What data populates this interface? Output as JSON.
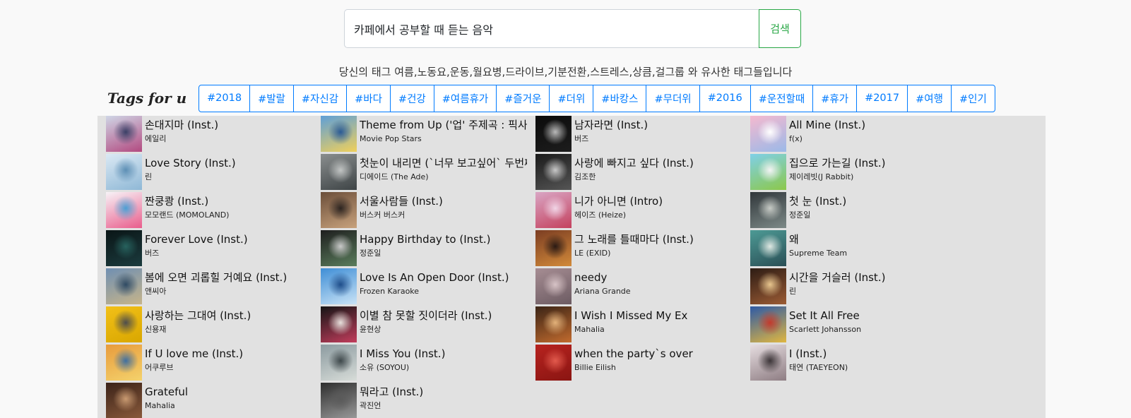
{
  "search": {
    "value": "카페에서 공부할 때 듣는 음악",
    "button_label": "검색"
  },
  "similar_text": "당신의 태그 여름,노동요,운동,월요병,드라이브,기분전환,스트레스,상큼,걸그룹 와 유사한 태그들입니다",
  "tags_title": "Tags for u",
  "tags": [
    "#2018",
    "#발랄",
    "#자신감",
    "#바다",
    "#건강",
    "#여름휴가",
    "#즐거운",
    "#더위",
    "#바캉스",
    "#무더위",
    "#2016",
    "#운전할때",
    "#휴가",
    "#2017",
    "#여행",
    "#인기"
  ],
  "songs": [
    [
      {
        "title": "손대지마 (Inst.)",
        "artist": "에일리",
        "colors": [
          "#cfd6e6",
          "#b24a80",
          "#3a3f66"
        ]
      },
      {
        "title": "Love Story (Inst.)",
        "artist": "린",
        "colors": [
          "#dbe9f4",
          "#8fb8d6",
          "#5d8fb5"
        ]
      },
      {
        "title": "짠쿵쾅 (Inst.)",
        "artist": "모모랜드 (MOMOLAND)",
        "colors": [
          "#f7f3f7",
          "#e95d8c",
          "#4c9fd4"
        ]
      },
      {
        "title": "Forever Love (Inst.)",
        "artist": "버즈",
        "colors": [
          "#0a1516",
          "#1b3b3e",
          "#27625e"
        ]
      },
      {
        "title": "봄에 오면 괴롭힐 거예요 (Inst.)",
        "artist": "앤씨아",
        "colors": [
          "#6f8fb2",
          "#c6b48a",
          "#2f4a63"
        ]
      },
      {
        "title": "사랑하는 그대여 (Inst.)",
        "artist": "신용재",
        "colors": [
          "#f2c018",
          "#d9a700",
          "#4d4d4d"
        ]
      },
      {
        "title": "If U love me (Inst.)",
        "artist": "어쿠루브",
        "colors": [
          "#e89b3c",
          "#f4d26c",
          "#3f6fa0"
        ]
      },
      {
        "title": "Grateful",
        "artist": "Mahalia",
        "colors": [
          "#3a2218",
          "#8a5a3b",
          "#c99a71"
        ]
      }
    ],
    [
      {
        "title": "Theme from Up ('업' 주제곡 : 픽사 영화 '업' 삽입곡)",
        "artist": "Movie Pop Stars",
        "colors": [
          "#5f9fd7",
          "#f0d05b",
          "#2a5a95"
        ]
      },
      {
        "title": "첫눈이 내리면 (`너무 보고싶어` 두번째 이야기)",
        "artist": "디에이드 (The Ade)",
        "colors": [
          "#8a8e8e",
          "#3e4446",
          "#c2c5c4"
        ]
      },
      {
        "title": "서울사람들 (Inst.)",
        "artist": "버스커 버스커",
        "colors": [
          "#6b4e3a",
          "#c8a27c",
          "#2c2420"
        ]
      },
      {
        "title": "Happy Birthday to (Inst.)",
        "artist": "정준일",
        "colors": [
          "#1e1e1e",
          "#5a7d5c",
          "#c9c9c9"
        ]
      },
      {
        "title": "Love Is An Open Door (Inst.)",
        "artist": "Frozen Karaoke",
        "colors": [
          "#3f8ed6",
          "#c9e3f6",
          "#1e4d8a"
        ]
      },
      {
        "title": "이별 참 못할 짓이더라 (Inst.)",
        "artist": "윤현상",
        "colors": [
          "#151515",
          "#c23d5c",
          "#e8e0dc"
        ]
      },
      {
        "title": "I Miss You (Inst.)",
        "artist": "소유 (SOYOU)",
        "colors": [
          "#8c9ba0",
          "#d7dcd8",
          "#3d474a"
        ]
      },
      {
        "title": "뭐라고 (Inst.)",
        "artist": "곽진언",
        "colors": [
          "#2e2e2e",
          "#9a9a9a",
          "#5a5a5a"
        ]
      }
    ],
    [
      {
        "title": "남자라면 (Inst.)",
        "artist": "버즈",
        "colors": [
          "#0b0b0b",
          "#1d1d1d",
          "#b9b9b9"
        ]
      },
      {
        "title": "사랑에 빠지고 싶다 (Inst.)",
        "artist": "김조한",
        "colors": [
          "#1a1a1a",
          "#555555",
          "#c8c8c8"
        ]
      },
      {
        "title": "니가 아니면 (Intro)",
        "artist": "헤이즈 (Heize)",
        "colors": [
          "#d9a6c4",
          "#c4415e",
          "#f1d5e6"
        ]
      },
      {
        "title": "그 노래를 틀때마다 (Inst.)",
        "artist": "LE (EXID)",
        "colors": [
          "#7b3d22",
          "#d28a3a",
          "#2a1a14"
        ]
      },
      {
        "title": "needy",
        "artist": "Ariana Grande",
        "colors": [
          "#a68d93",
          "#6c5b62",
          "#d7c3c6"
        ]
      },
      {
        "title": "I Wish I Missed My Ex",
        "artist": "Mahalia",
        "colors": [
          "#3a2416",
          "#c26b2e",
          "#e3b27a"
        ]
      },
      {
        "title": "when the party`s over",
        "artist": "Billie Eilish",
        "colors": [
          "#b7231f",
          "#8a1512",
          "#e25a4d"
        ]
      }
    ],
    [
      {
        "title": "All Mine (Inst.)",
        "artist": "f(x)",
        "colors": [
          "#f5b9cf",
          "#9bb9e8",
          "#ffffff"
        ]
      },
      {
        "title": "집으로 가는길 (Inst.)",
        "artist": "제이레빗(J Rabbit)",
        "colors": [
          "#7fd0e8",
          "#8cc84b",
          "#f4f4f4"
        ]
      },
      {
        "title": "첫 눈 (Inst.)",
        "artist": "정준일",
        "colors": [
          "#30363a",
          "#7d8a88",
          "#c7cbc6"
        ]
      },
      {
        "title": "왜",
        "artist": "Supreme Team",
        "colors": [
          "#4d9a95",
          "#2a4f56",
          "#dfe8e3"
        ]
      },
      {
        "title": "시간을 거슬러 (Inst.)",
        "artist": "린",
        "colors": [
          "#2d1c14",
          "#9b5b34",
          "#e8c68e"
        ]
      },
      {
        "title": "Set It All Free",
        "artist": "Scarlett Johansson",
        "colors": [
          "#2e5aa6",
          "#e0b640",
          "#c43a2c"
        ]
      },
      {
        "title": "I (Inst.)",
        "artist": "태연 (TAEYEON)",
        "colors": [
          "#e6dde0",
          "#8e7d83",
          "#3c3538"
        ]
      }
    ]
  ]
}
